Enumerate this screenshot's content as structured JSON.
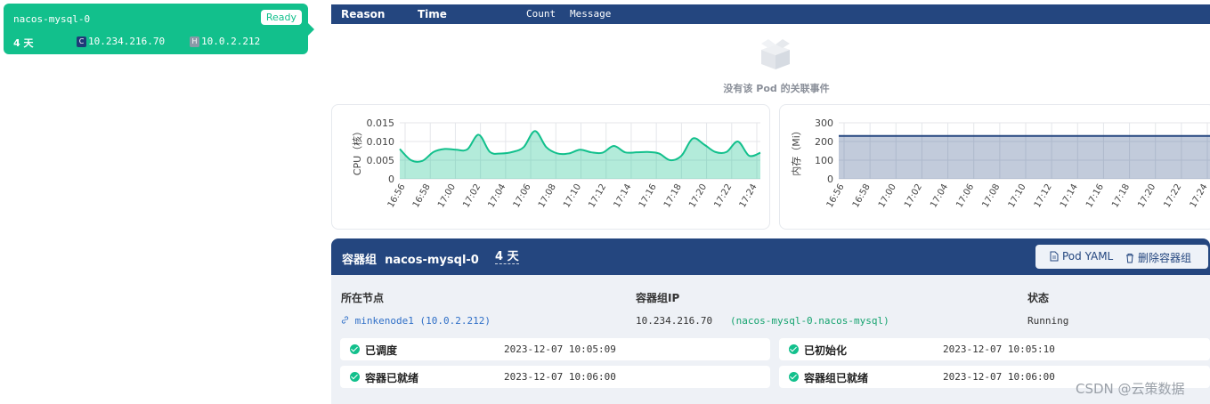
{
  "pod_card": {
    "name": "nacos-mysql-0",
    "status": "Ready",
    "age": "4 天",
    "container_ip": "10.234.216.70",
    "host_ip": "10.0.2.212",
    "container_badge": "C",
    "host_badge": "H"
  },
  "events": {
    "columns": [
      "Reason",
      "Time",
      "Count",
      "Message"
    ],
    "empty_text": "没有该 Pod 的关联事件"
  },
  "charts": [
    {
      "type": "area",
      "ylabel": "CPU（核）",
      "ylim": [
        0,
        0.015
      ],
      "yticks": [
        "0.015",
        "0.010",
        "0.005",
        "0"
      ],
      "color": "#12c08c",
      "x": [
        "16:56",
        "16:58",
        "17:00",
        "17:02",
        "17:04",
        "17:06",
        "17:08",
        "17:10",
        "17:12",
        "17:14",
        "17:16",
        "17:18",
        "17:20",
        "17:22",
        "17:24"
      ],
      "values": [
        0.008,
        0.005,
        0.0048,
        0.0072,
        0.008,
        0.0078,
        0.0079,
        0.0118,
        0.0072,
        0.0068,
        0.0072,
        0.0085,
        0.0128,
        0.0085,
        0.0068,
        0.0068,
        0.0078,
        0.0071,
        0.007,
        0.0088,
        0.0071,
        0.0071,
        0.0072,
        0.0068,
        0.005,
        0.0062,
        0.0108,
        0.0092,
        0.0072,
        0.0072,
        0.01,
        0.0062,
        0.007
      ]
    },
    {
      "type": "area",
      "ylabel": "内存（Mi）",
      "ylim": [
        0,
        300
      ],
      "yticks": [
        "300",
        "200",
        "100",
        "0"
      ],
      "color": "#24467f",
      "x": [
        "16:56",
        "16:58",
        "17:00",
        "17:02",
        "17:04",
        "17:06",
        "17:08",
        "17:10",
        "17:12",
        "17:14",
        "17:16",
        "17:18",
        "17:20",
        "17:22",
        "17:24"
      ],
      "values": [
        230,
        230,
        230,
        230,
        230,
        230,
        230,
        230,
        230,
        230,
        230,
        230,
        230,
        230,
        230
      ]
    }
  ],
  "pod_detail": {
    "title_label": "容器组",
    "name": "nacos-mysql-0",
    "age": "4 天",
    "yaml_button": "Pod YAML",
    "delete_button": "删除容器组",
    "node_label": "所在节点",
    "node_value": "minkenode1 (10.0.2.212)",
    "ip_label": "容器组IP",
    "ip_value": "10.234.216.70",
    "dns_value": "(nacos-mysql-0.nacos-mysql)",
    "status_label": "状态",
    "status_value": "Running",
    "conditions": [
      {
        "name": "已调度",
        "time": "2023-12-07 10:05:09"
      },
      {
        "name": "已初始化",
        "time": "2023-12-07 10:05:10"
      },
      {
        "name": "容器已就绪",
        "time": "2023-12-07 10:06:00"
      },
      {
        "name": "容器组已就绪",
        "time": "2023-12-07 10:06:00"
      }
    ]
  },
  "watermark": "CSDN @云策数据"
}
